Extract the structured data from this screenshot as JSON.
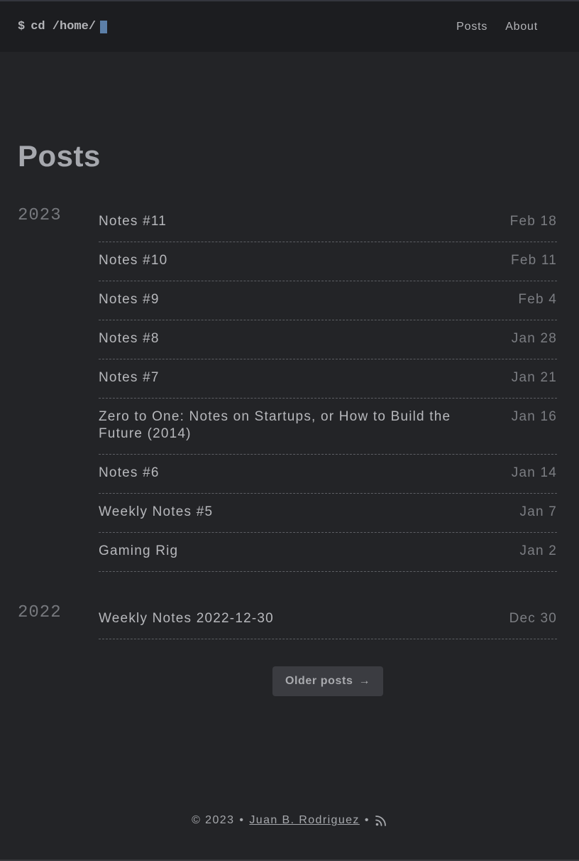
{
  "header": {
    "logo_prompt": "$",
    "logo_text": "cd /home/",
    "nav": [
      {
        "label": "Posts"
      },
      {
        "label": "About"
      }
    ]
  },
  "main": {
    "title": "Posts",
    "groups": [
      {
        "year": "2023",
        "posts": [
          {
            "title": "Notes #11",
            "date": "Feb 18"
          },
          {
            "title": "Notes #10",
            "date": "Feb 11"
          },
          {
            "title": "Notes #9",
            "date": "Feb 4"
          },
          {
            "title": "Notes #8",
            "date": "Jan 28"
          },
          {
            "title": "Notes #7",
            "date": "Jan 21"
          },
          {
            "title": "Zero to One: Notes on Startups, or How to Build the Future (2014)",
            "date": "Jan 16"
          },
          {
            "title": "Notes #6",
            "date": "Jan 14"
          },
          {
            "title": "Weekly Notes #5",
            "date": "Jan 7"
          },
          {
            "title": "Gaming Rig",
            "date": "Jan 2"
          }
        ]
      },
      {
        "year": "2022",
        "posts": [
          {
            "title": "Weekly Notes 2022-12-30",
            "date": "Dec 30"
          }
        ]
      }
    ],
    "pager": {
      "older_label": "Older posts",
      "older_arrow": "→"
    }
  },
  "footer": {
    "copyright": "© 2023",
    "bullet": "•",
    "author": "Juan B. Rodriguez",
    "rss_icon": "rss-icon"
  }
}
